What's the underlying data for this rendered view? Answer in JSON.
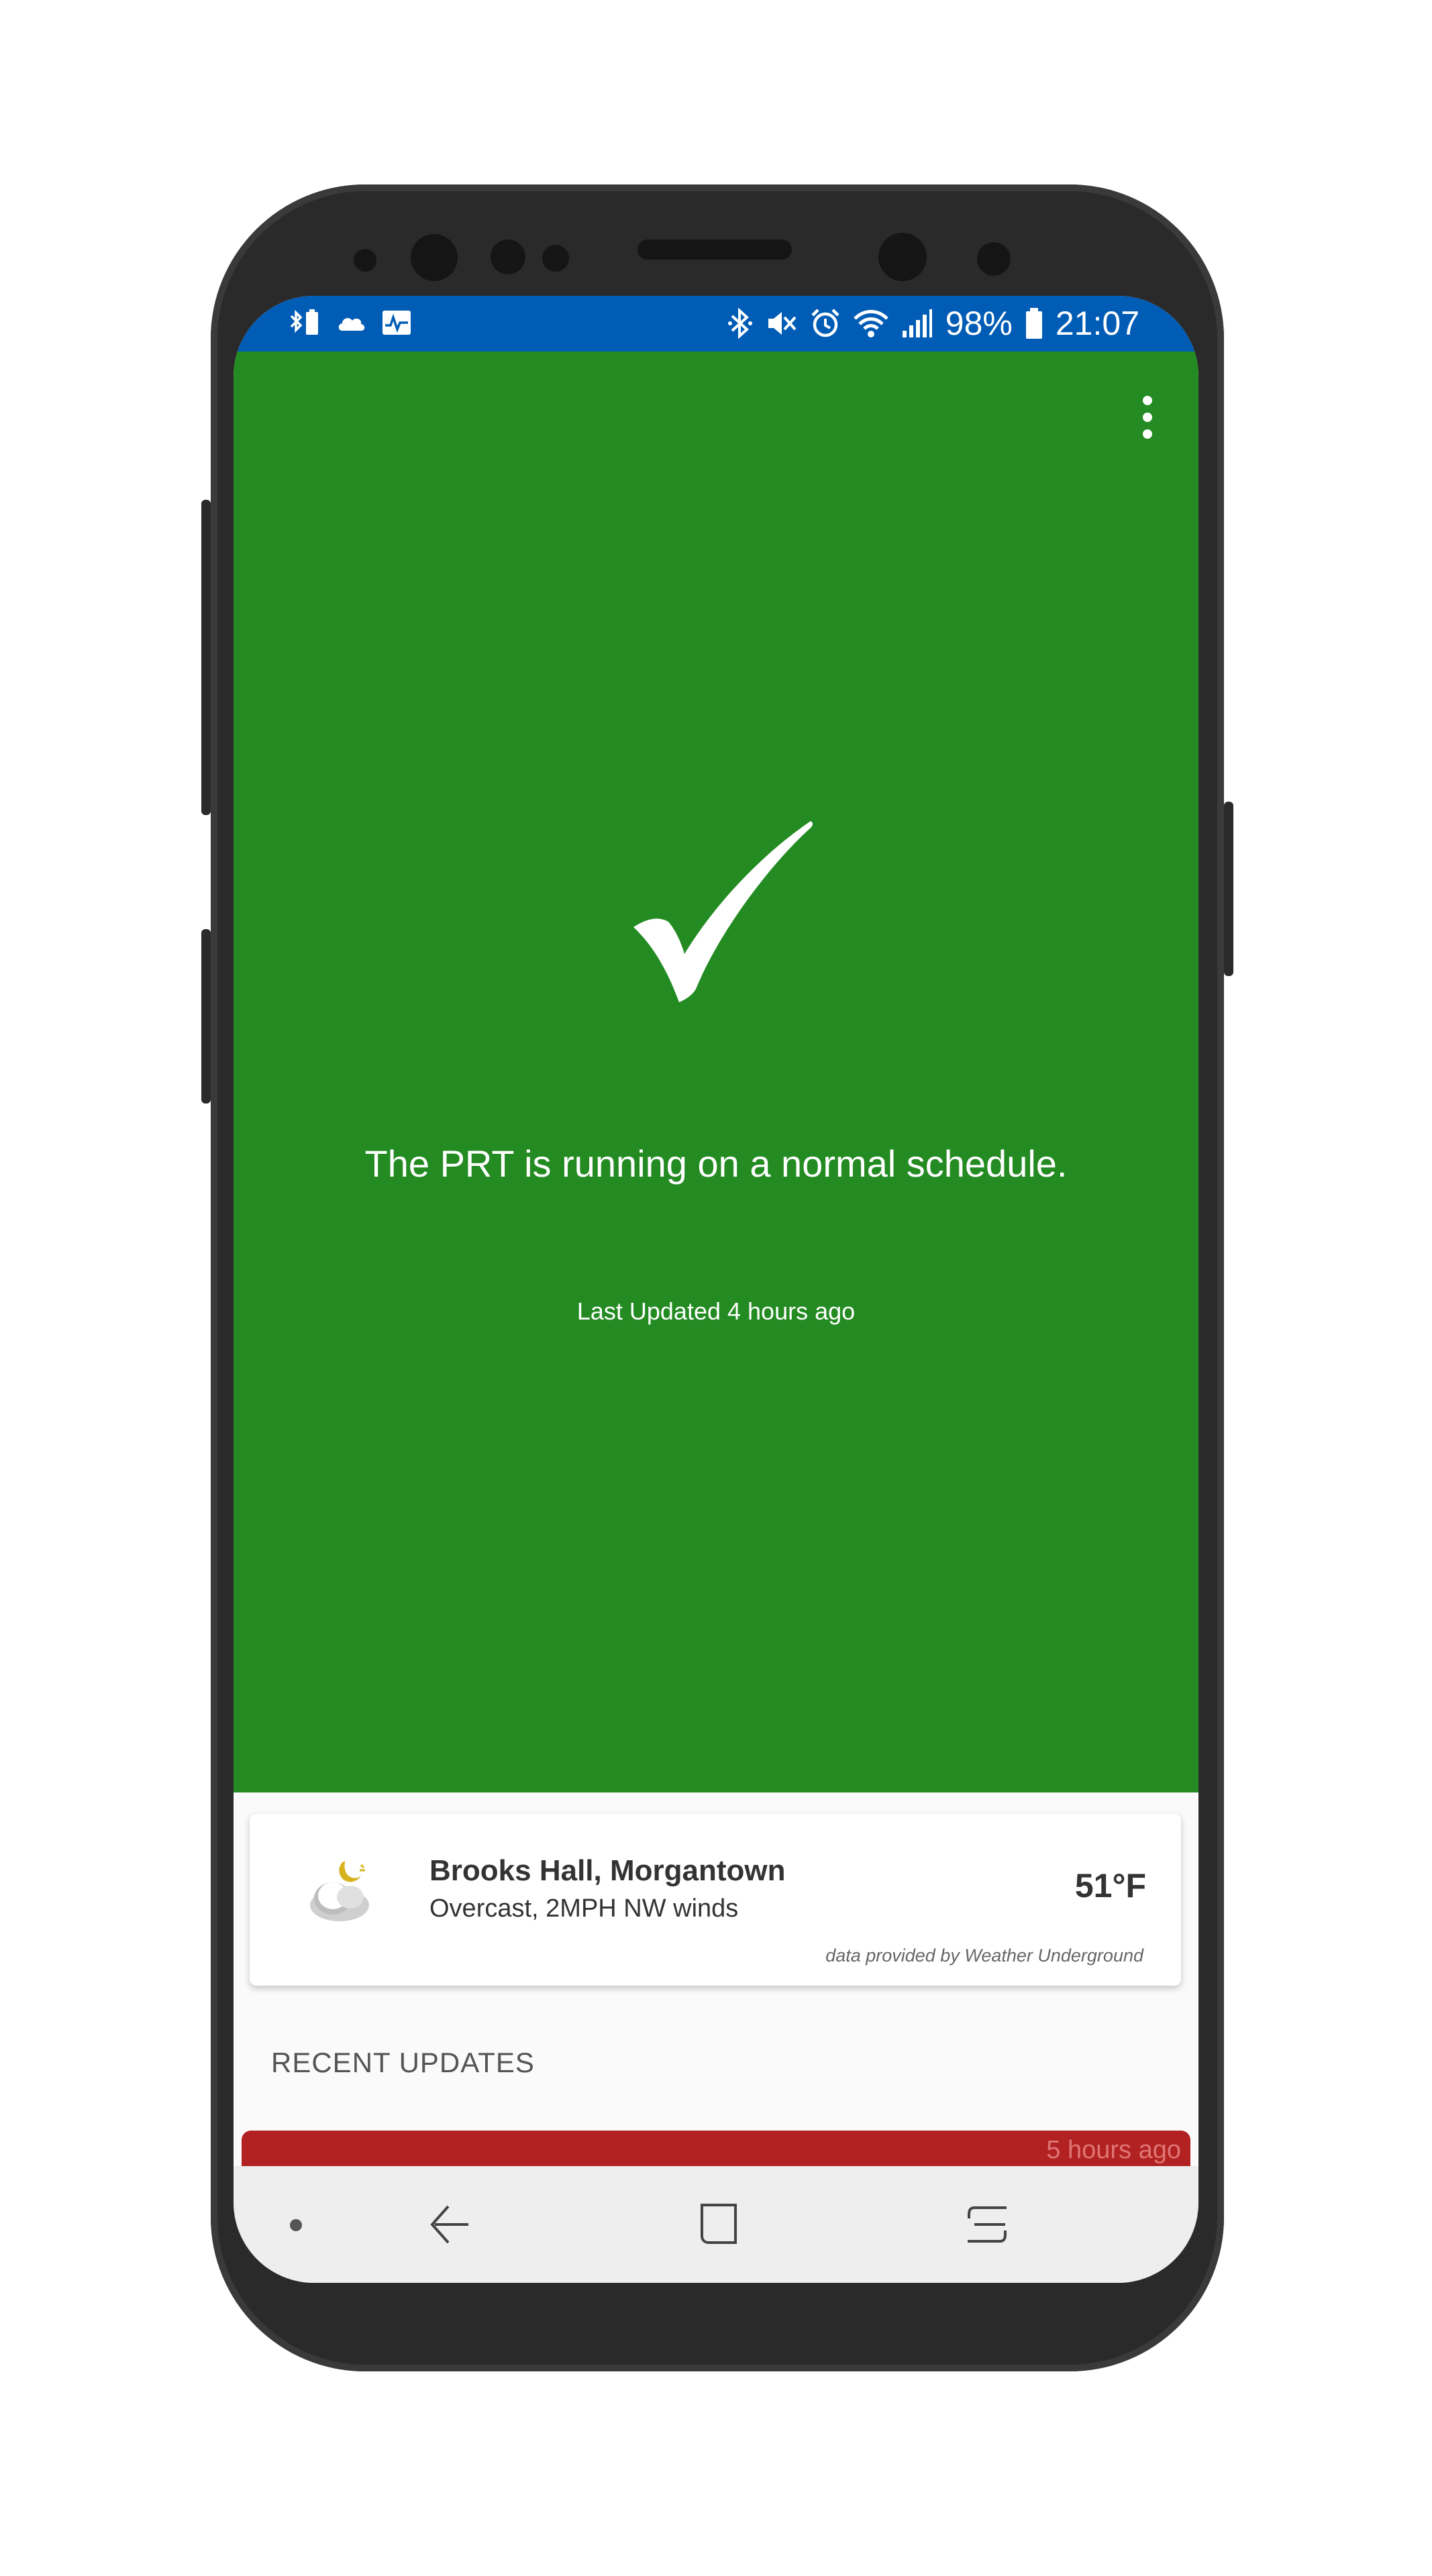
{
  "status_bar": {
    "battery": "98%",
    "time": "21:07",
    "left_icons": [
      "bluetooth-battery-icon",
      "cloud-icon",
      "activity-icon"
    ],
    "right_icons": [
      "bluetooth-icon",
      "mute-icon",
      "alarm-icon",
      "wifi-icon",
      "signal-icon",
      "battery-icon"
    ],
    "color": "#005cb5"
  },
  "hero": {
    "background": "#238b22",
    "icon": "checkmark-icon",
    "status_message": "The PRT is running on a normal schedule.",
    "last_updated": "Last Updated 4 hours ago"
  },
  "weather": {
    "icon": "partly-cloudy-night-icon",
    "location": "Brooks Hall, Morgantown",
    "conditions": "Overcast, 2MPH NW winds",
    "temperature": "51°F",
    "credit": "data provided by Weather Underground"
  },
  "recent_updates": {
    "header": "RECENT UPDATES",
    "items": [
      {
        "time": "5 hours ago",
        "color": "#b22222"
      }
    ]
  },
  "nav_bar": {
    "icons": [
      "nav-dot-icon",
      "back-icon",
      "home-icon",
      "recents-icon"
    ]
  }
}
